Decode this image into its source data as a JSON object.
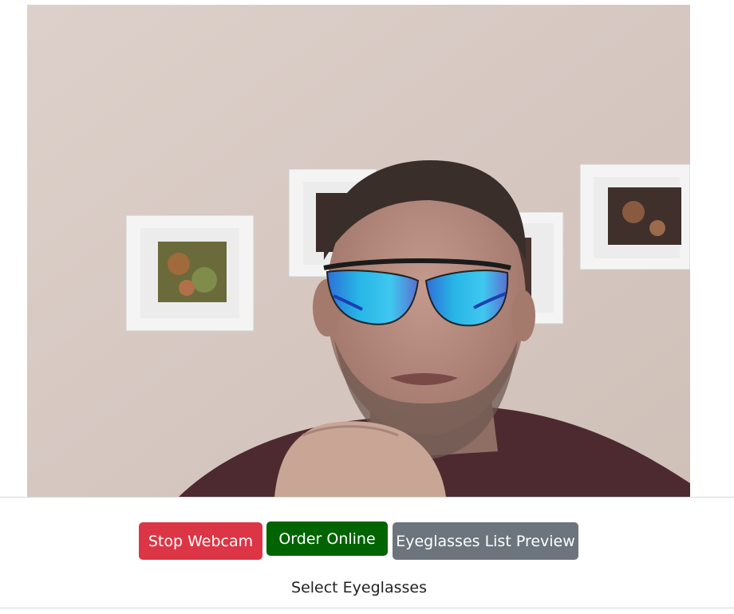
{
  "webcam": {
    "overlay": "sunglasses-overlay"
  },
  "controls": {
    "stop_webcam_label": "Stop Webcam",
    "order_online_label": "Order Online",
    "eyeglasses_list_label": "Eyeglasses List Preview"
  },
  "footer": {
    "select_label": "Select Eyeglasses"
  },
  "colors": {
    "stop_button": "#dc3545",
    "order_button": "#006400",
    "list_button": "#6c757d"
  }
}
